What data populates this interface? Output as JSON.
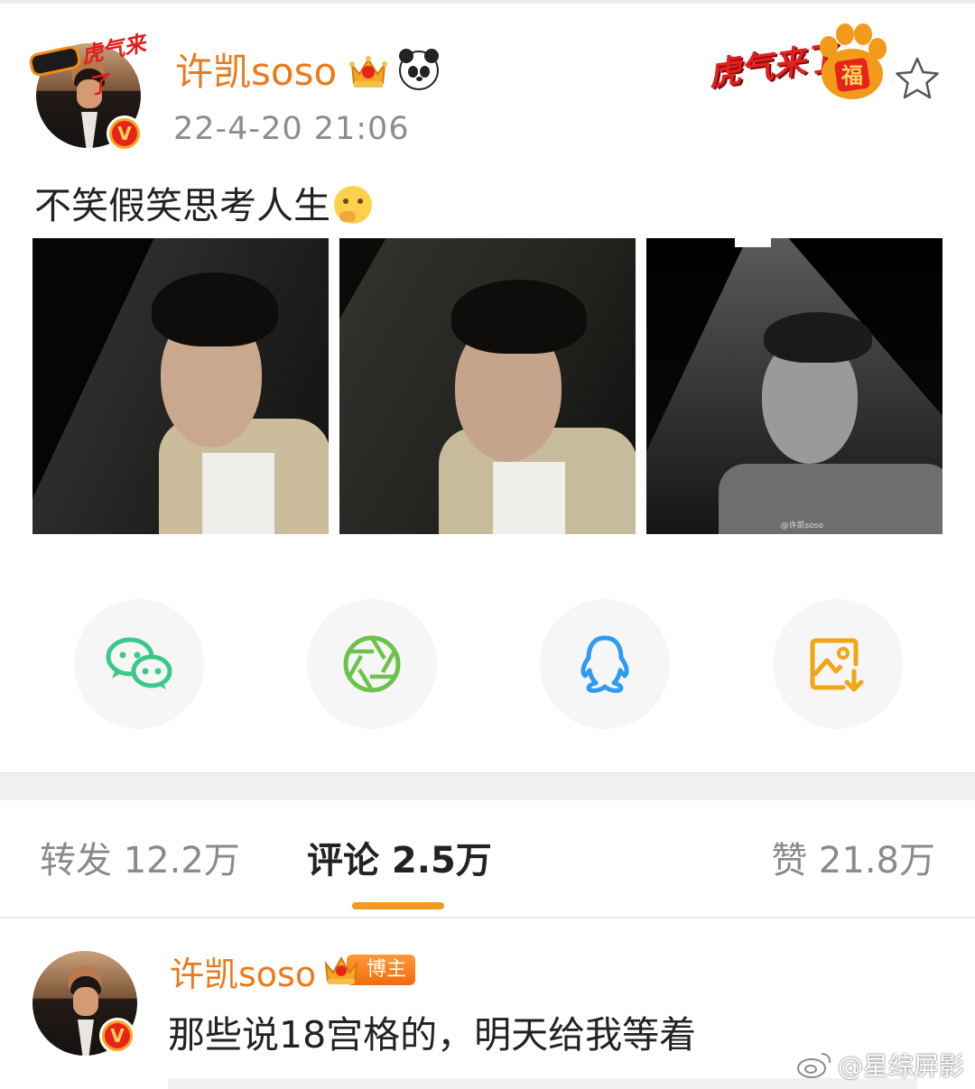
{
  "post": {
    "username": "许凯soso",
    "time": "22-4-20 21:06",
    "text": "不笑假笑思考人生",
    "avatar_sticker_text": "虎气来了",
    "header_sticker_text": "虎气来了",
    "paw_text": "福",
    "verified_mark": "V",
    "photo_watermark": "@许凯soso"
  },
  "share": [
    {
      "name": "wechat-icon",
      "color": "#3cc78b"
    },
    {
      "name": "moments-icon",
      "color": "#6cc24a"
    },
    {
      "name": "qq-icon",
      "color": "#2e9bf0"
    },
    {
      "name": "save-image-icon",
      "color": "#f2a515"
    }
  ],
  "tabs": {
    "repost": "转发 12.2万",
    "comments": "评论 2.5万",
    "likes": "赞 21.8万"
  },
  "comment": {
    "username": "许凯soso",
    "badge": "博主",
    "text": "那些说18宫格的，明天给我等着"
  },
  "watermark": "@星综屏影",
  "colors": {
    "accent_orange": "#ea7a1a",
    "tab_underline": "#f39a1b"
  }
}
